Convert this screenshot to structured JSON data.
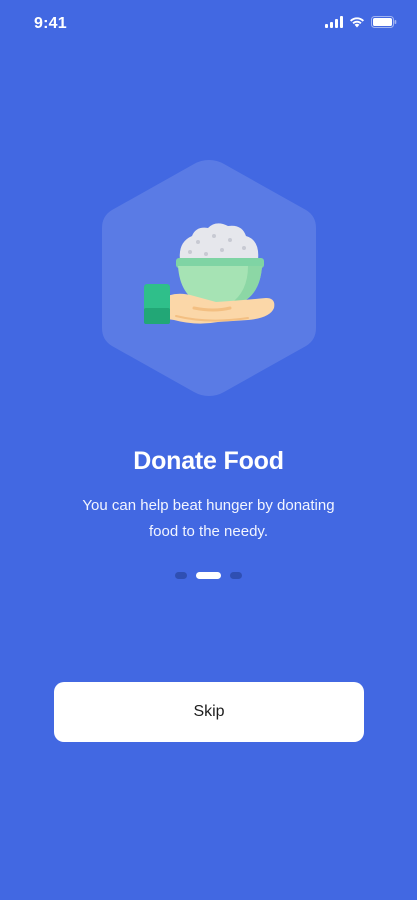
{
  "status_bar": {
    "time": "9:41",
    "signal_icon": "cellular-signal-icon",
    "wifi_icon": "wifi-icon",
    "battery_icon": "battery-icon"
  },
  "onboarding": {
    "illustration": "hand-holding-rice-bowl-illustration",
    "title": "Donate Food",
    "description": "You can help beat hunger by donating food to the needy.",
    "pagination": {
      "total_pages": 3,
      "current_page": 2
    }
  },
  "actions": {
    "skip_label": "Skip"
  },
  "colors": {
    "background": "#4268e2",
    "button_background": "#ffffff",
    "inactive_dot": "#2f4fb3"
  }
}
